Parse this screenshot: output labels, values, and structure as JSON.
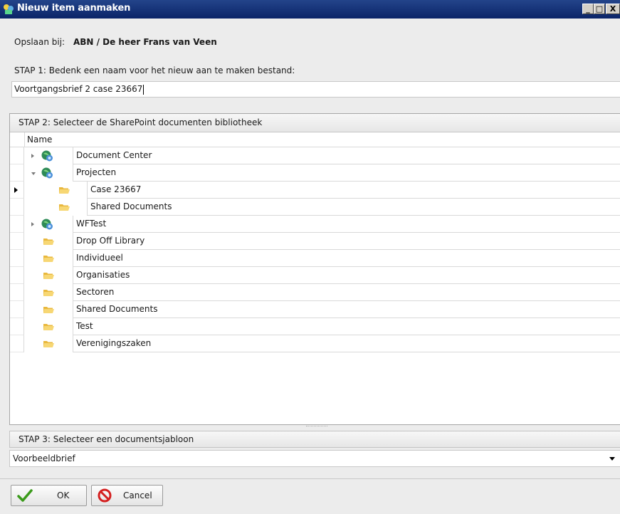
{
  "window": {
    "title": "Nieuw item aanmaken",
    "controls": {
      "minimize": "_",
      "maximize": "□",
      "close": "X"
    }
  },
  "save_location": {
    "label": "Opslaan bij:",
    "value": "ABN / De heer Frans van Veen"
  },
  "step1": {
    "label": "STAP 1: Bedenk een naam voor het nieuw aan te maken bestand:",
    "value": "Voortgangsbrief 2 case 23667"
  },
  "step2": {
    "label": "STAP 2: Selecteer de SharePoint documenten bibliotheek",
    "column_header": "Name",
    "rows": [
      {
        "label": "Document Center",
        "icon": "site-icon",
        "level": 0,
        "expander": "collapsed",
        "current": false
      },
      {
        "label": "Projecten",
        "icon": "site-icon",
        "level": 0,
        "expander": "expanded",
        "current": false
      },
      {
        "label": "Case 23667",
        "icon": "folder-icon",
        "level": 1,
        "expander": "none",
        "current": true
      },
      {
        "label": "Shared Documents",
        "icon": "folder-icon",
        "level": 1,
        "expander": "none",
        "current": false
      },
      {
        "label": "WFTest",
        "icon": "site-icon",
        "level": 0,
        "expander": "collapsed",
        "current": false
      },
      {
        "label": "Drop Off Library",
        "icon": "folder-icon",
        "level": 0,
        "expander": "none",
        "current": false
      },
      {
        "label": "Individueel",
        "icon": "folder-icon",
        "level": 0,
        "expander": "none",
        "current": false
      },
      {
        "label": "Organisaties",
        "icon": "folder-icon",
        "level": 0,
        "expander": "none",
        "current": false
      },
      {
        "label": "Sectoren",
        "icon": "folder-icon",
        "level": 0,
        "expander": "none",
        "current": false
      },
      {
        "label": "Shared Documents",
        "icon": "folder-icon",
        "level": 0,
        "expander": "none",
        "current": false
      },
      {
        "label": "Test",
        "icon": "folder-icon",
        "level": 0,
        "expander": "none",
        "current": false
      },
      {
        "label": "Verenigingszaken",
        "icon": "folder-icon",
        "level": 0,
        "expander": "none",
        "current": false
      }
    ]
  },
  "step3": {
    "label": "STAP 3: Selecteer een documentsjabloon",
    "selected": "Voorbeeldbrief"
  },
  "buttons": {
    "ok": "OK",
    "cancel": "Cancel"
  },
  "colors": {
    "titlebar": "#0b2468",
    "ok_check": "#3a9a1a",
    "cancel_red": "#d42020",
    "folder": "#f2c94c"
  }
}
